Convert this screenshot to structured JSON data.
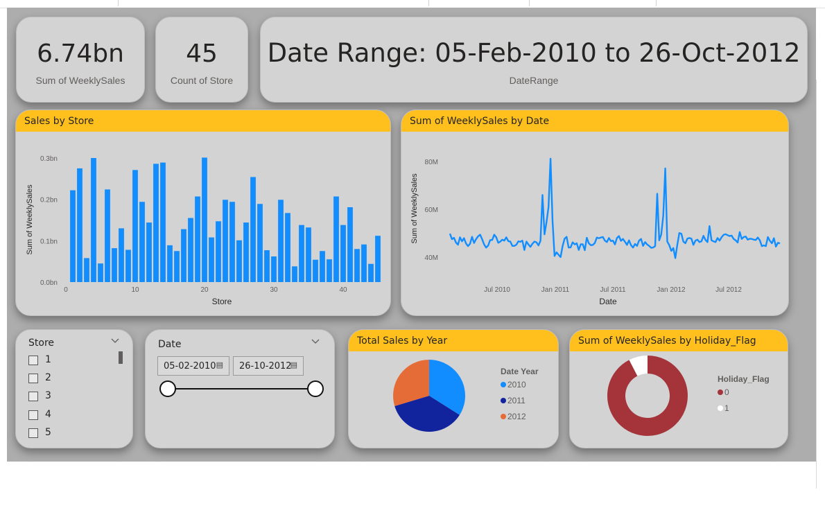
{
  "kpis": {
    "sales": {
      "value": "6.74bn",
      "label": "Sum of WeeklySales"
    },
    "stores": {
      "value": "45",
      "label": "Count of Store"
    },
    "date_range": {
      "value": "Date Range: 05-Feb-2010 to 26-Oct-2012",
      "label": "DateRange"
    }
  },
  "colors": {
    "bar": "#118dff",
    "header": "#ffc01e",
    "y2010": "#118dff",
    "y2011": "#12239e",
    "y2012": "#e66c37",
    "flag0": "#a4343a",
    "flag1": "#ffffff"
  },
  "store_chart": {
    "title": "Sales by Store",
    "chart_data": {
      "type": "bar",
      "xlabel": "Store",
      "ylabel": "Sum of WeeklySales",
      "x_ticks": [
        0,
        10,
        20,
        30,
        40
      ],
      "y_ticks": [
        "0.0bn",
        "0.1bn",
        "0.2bn",
        "0.3bn"
      ],
      "ylim": [
        0,
        0.3
      ],
      "categories": [
        1,
        2,
        3,
        4,
        5,
        6,
        7,
        8,
        9,
        10,
        11,
        12,
        13,
        14,
        15,
        16,
        17,
        18,
        19,
        20,
        21,
        22,
        23,
        24,
        25,
        26,
        27,
        28,
        29,
        30,
        31,
        32,
        33,
        34,
        35,
        36,
        37,
        38,
        39,
        40,
        41,
        42,
        43,
        44,
        45
      ],
      "values": [
        0.222,
        0.275,
        0.058,
        0.3,
        0.045,
        0.224,
        0.082,
        0.13,
        0.078,
        0.271,
        0.194,
        0.144,
        0.286,
        0.289,
        0.089,
        0.075,
        0.128,
        0.155,
        0.207,
        0.301,
        0.108,
        0.147,
        0.199,
        0.194,
        0.101,
        0.144,
        0.254,
        0.189,
        0.077,
        0.062,
        0.199,
        0.167,
        0.038,
        0.138,
        0.132,
        0.054,
        0.075,
        0.055,
        0.207,
        0.138,
        0.181,
        0.08,
        0.091,
        0.044,
        0.112
      ]
    }
  },
  "date_chart": {
    "title": "Sum of WeeklySales by Date",
    "chart_data": {
      "type": "line",
      "xlabel": "Date",
      "ylabel": "Sum of WeeklySales",
      "y_ticks": [
        "40M",
        "60M",
        "80M"
      ],
      "x_ticks": [
        "Jul 2010",
        "Jan 2011",
        "Jul 2011",
        "Jan 2012",
        "Jul 2012"
      ],
      "x_start": "2010-02-05",
      "x_step_days": 7,
      "ylim": [
        38,
        84
      ],
      "values": [
        49.8,
        48.3,
        48.2,
        46.9,
        45.0,
        48.3,
        47.4,
        47.2,
        45.8,
        47.8,
        46.3,
        44.8,
        45.4,
        50.4,
        46.5,
        45.2,
        45.2,
        47.6,
        46.5,
        48.4,
        48.0,
        49.9,
        48.6,
        47.8,
        45.6,
        47.5,
        46.1,
        47.6,
        48.3,
        47.9,
        48.3,
        47.0,
        46.8,
        45.1,
        47.4,
        45.5,
        46.0,
        45.6,
        48.0,
        46.9,
        48.4,
        47.7,
        46.5,
        46.2,
        45.8,
        45.8,
        42.8,
        46.1,
        47.2,
        46.9,
        47.2,
        45.8,
        45.5,
        46.4,
        47.3,
        45.6,
        44.7,
        46.6,
        45.2,
        43.9,
        45.6,
        44.7,
        45.9,
        44.3,
        45.8,
        41.6,
        65.8,
        49.2,
        52.6,
        57.3,
        61.0,
        80.9,
        55.6,
        40.4,
        42.1,
        40.0,
        40.5,
        40.2,
        39.3,
        44.0,
        46.7,
        47.8,
        48.4,
        44.0,
        44.5,
        43.8,
        45.8,
        45.1,
        45.8,
        45.6,
        45.7,
        42.1,
        46.5,
        45.1,
        43.2,
        48.1,
        47.2,
        45.6,
        46.0,
        44.4,
        46.1,
        47.4,
        48.5,
        47.1,
        48.6,
        48.7,
        48.0,
        46.9,
        46.9,
        45.6,
        49.9,
        46.6,
        46.0,
        48.4,
        45.4,
        45.2,
        47.2,
        46.9,
        46.5,
        45.2,
        46.4,
        44.9,
        43.0,
        45.9,
        44.1,
        44.7,
        44.5,
        47.5,
        47.4,
        43.7,
        46.3,
        45.0,
        45.5,
        44.6,
        45.8,
        45.6,
        42.7,
        43.0,
        44.1,
        44.6,
        66.6,
        46.0,
        49.2,
        55.6,
        59.5,
        77.0,
        46.0,
        44.1,
        42.8,
        43.5,
        39.6,
        45.2,
        49.6,
        50.2,
        46.5,
        45.6,
        46.8,
        48.2,
        48.4,
        45.1,
        47.5,
        47.2,
        46.9,
        46.2,
        49.0,
        48.0,
        46.4,
        53.0,
        47.5,
        46.7,
        46.4,
        46.3,
        47.7,
        46.8,
        48.4,
        48.3,
        49.5,
        50.0,
        49.4,
        48.7,
        49.2,
        47.5,
        47.8,
        46.1,
        50.9,
        47.6,
        47.8,
        49.6,
        47.3,
        47.9,
        47.6,
        46.7,
        47.6,
        47.5,
        48.2,
        47.6,
        45.7,
        45.6,
        44.6,
        44.4,
        44.3,
        46.8,
        46.6,
        46.0,
        47.6,
        45.7,
        44.4,
        45.5,
        45.7
      ],
      "display_values": [
        49.8,
        47.5,
        48.1,
        46.1,
        45.2,
        48.3,
        46.6,
        47.9,
        45.7,
        44.6,
        45.6,
        48.5,
        45.9,
        47.5,
        48.7,
        49.4,
        47.5,
        45.3,
        44.0,
        44.8,
        47.1,
        47.2,
        49.4,
        48.3,
        46.0,
        46.5,
        47.3,
        46.9,
        48.3,
        46.7,
        46.5,
        44.7,
        44.7,
        45.2,
        46.6,
        46.4,
        46.9,
        43.0,
        46.5,
        45.3,
        44.3,
        45.6,
        46.5,
        46.2,
        44.9,
        46.8,
        66.0,
        49.5,
        54.6,
        61.0,
        81.2,
        55.2,
        40.5,
        42.0,
        41.0,
        40.0,
        44.6,
        47.7,
        48.5,
        44.0,
        44.1,
        46.2,
        45.3,
        45.8,
        43.0,
        45.4,
        45.4,
        42.9,
        48.1,
        45.8,
        45.0,
        45.1,
        45.9,
        48.2,
        47.9,
        48.2,
        48.4,
        46.9,
        46.3,
        48.0,
        46.7,
        46.9,
        45.3,
        48.0,
        48.8,
        46.8,
        47.6,
        46.4,
        45.1,
        47.0,
        45.0,
        44.0,
        45.5,
        44.7,
        46.9,
        47.6,
        44.7,
        46.3,
        45.3,
        44.7,
        43.9,
        44.0,
        44.6,
        66.5,
        47.0,
        49.5,
        57.3,
        77.1,
        46.5,
        45.0,
        42.6,
        43.8,
        39.6,
        45.2,
        50.1,
        49.8,
        46.5,
        45.8,
        47.7,
        48.0,
        47.7,
        45.1,
        46.9,
        47.3,
        46.3,
        46.6,
        48.9,
        47.2,
        46.3,
        53.0,
        47.0,
        46.6,
        46.3,
        48.0,
        46.9,
        48.3,
        49.3,
        49.6,
        49.2,
        48.8,
        49.0,
        47.6,
        47.0,
        46.1,
        50.5,
        47.6,
        48.4,
        48.6,
        47.3,
        47.7,
        47.6,
        47.3,
        47.2,
        48.2,
        47.0,
        44.6,
        44.9,
        44.6,
        48.4,
        46.8,
        45.8,
        47.9,
        44.4,
        46.0,
        45.7
      ]
    }
  },
  "year_chart": {
    "title": "Total Sales by Year",
    "chart_data": {
      "type": "pie",
      "legend_title": "Date Year",
      "labels": [
        "2010",
        "2011",
        "2012"
      ],
      "values": [
        2.29,
        2.45,
        2.0
      ]
    }
  },
  "holiday_chart": {
    "title": "Sum of WeeklySales by Holiday_Flag",
    "chart_data": {
      "type": "donut",
      "legend_title": "Holiday_Flag",
      "labels": [
        "0",
        "1"
      ],
      "values": [
        6.23,
        0.51
      ]
    }
  },
  "store_slicer": {
    "title": "Store",
    "items": [
      "1",
      "2",
      "3",
      "4",
      "5"
    ]
  },
  "date_slicer": {
    "title": "Date",
    "start": "05-02-2010",
    "end": "26-10-2012"
  }
}
